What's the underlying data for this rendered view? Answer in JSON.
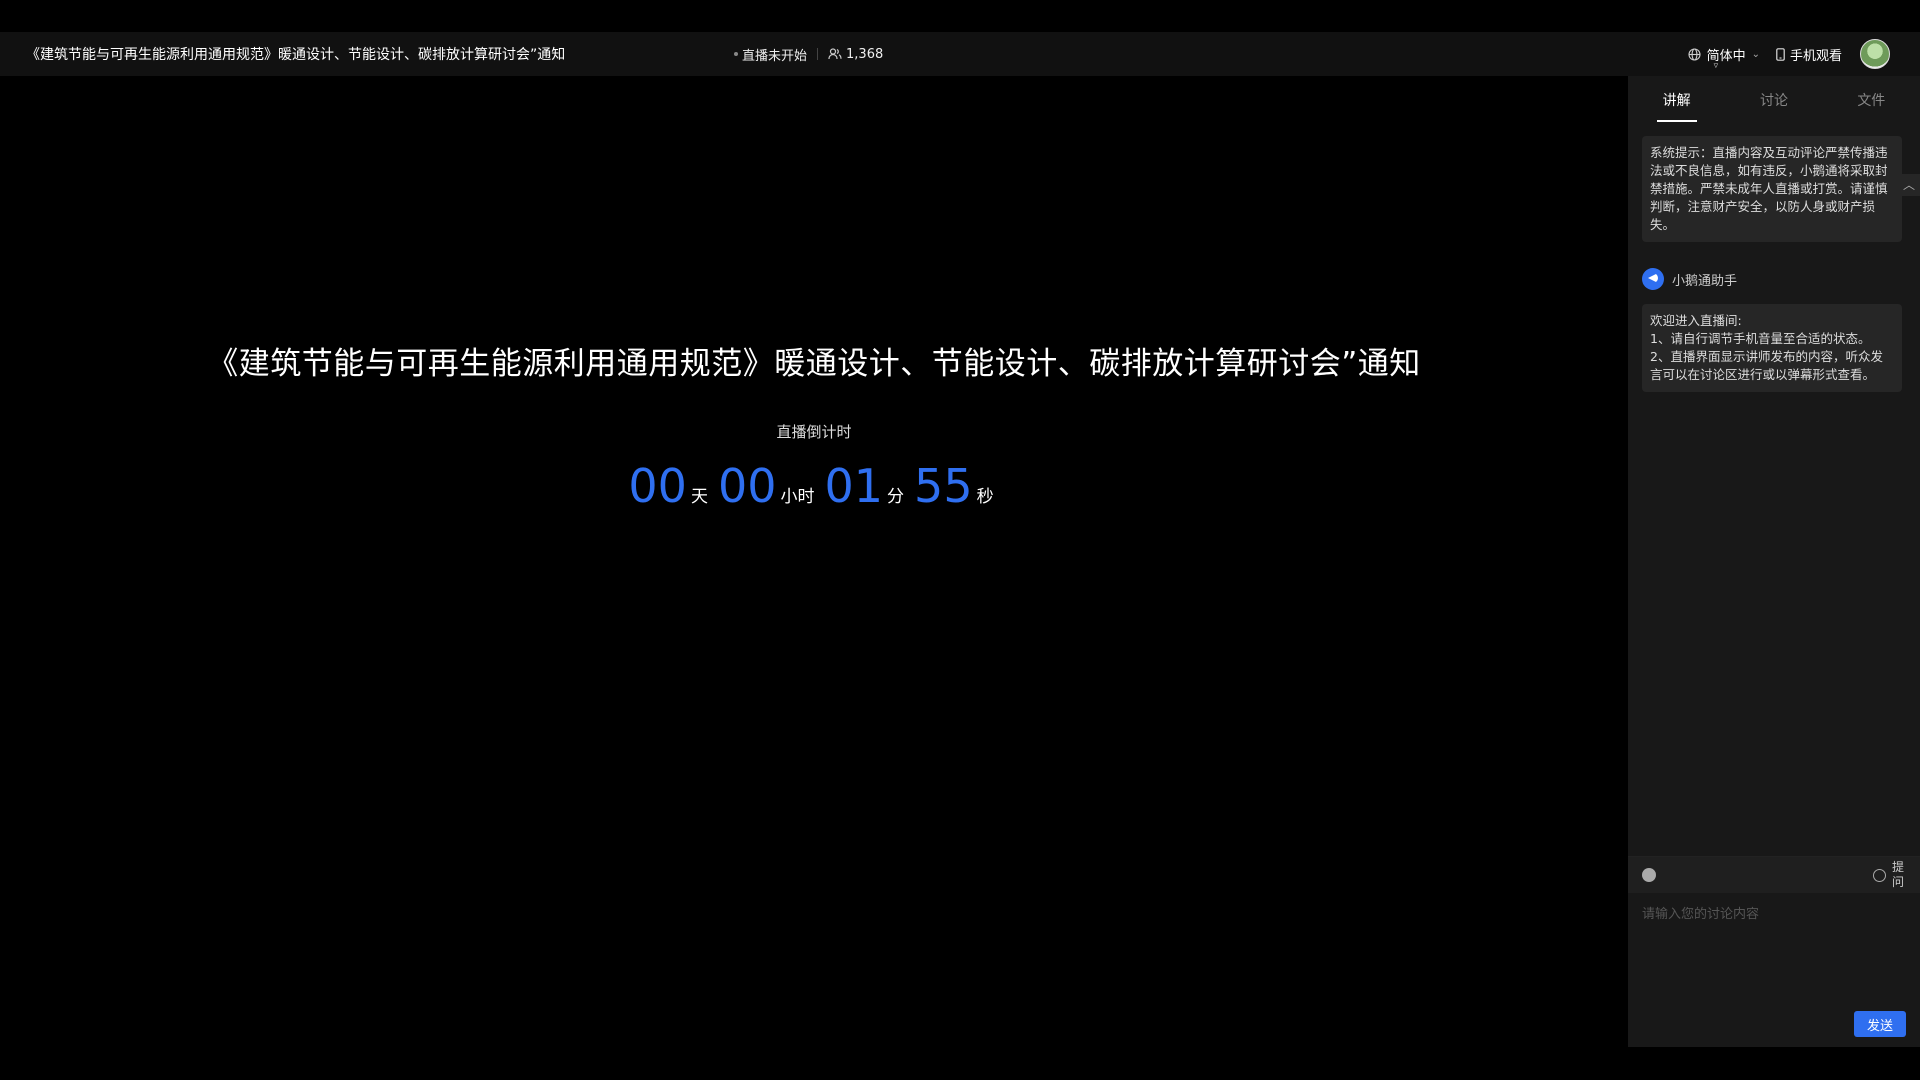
{
  "header": {
    "title": "《建筑节能与可再生能源利用通用规范》暖通设计、节能设计、碳排放计算研讨会”通知",
    "status": "直播未开始",
    "viewer_count": "1,368",
    "language": "简体中",
    "mobile_watch": "手机观看"
  },
  "main": {
    "title": "《建筑节能与可再生能源利用通用规范》暖通设计、节能设计、碳排放计算研讨会”通知",
    "countdown_label": "直播倒计时",
    "countdown": {
      "days": "00",
      "days_unit": "天",
      "hours": "00",
      "hours_unit": "小时",
      "minutes": "01",
      "minutes_unit": "分",
      "seconds": "55",
      "seconds_unit": "秒"
    }
  },
  "panel": {
    "tabs": [
      {
        "label": "讲解"
      },
      {
        "label": "讨论"
      },
      {
        "label": "文件"
      }
    ],
    "system_notice": "系统提示：直播内容及互动评论严禁传播违法或不良信息，如有违反，小鹅通将采取封禁措施。严禁未成年人直播或打赏。请谨慎判断，注意财产安全，以防人身或财产损失。",
    "assistant_name": "小鹅通助手",
    "welcome": {
      "line1": "欢迎进入直播间:",
      "line2": "1、请自行调节手机音量至合适的状态。",
      "line3": "2、直播界面显示讲师发布的内容，听众发言可以在讨论区进行或以弹幕形式查看。"
    },
    "composer": {
      "ask_label": "提问",
      "placeholder": "请输入您的讨论内容",
      "send_label": "发送"
    }
  }
}
